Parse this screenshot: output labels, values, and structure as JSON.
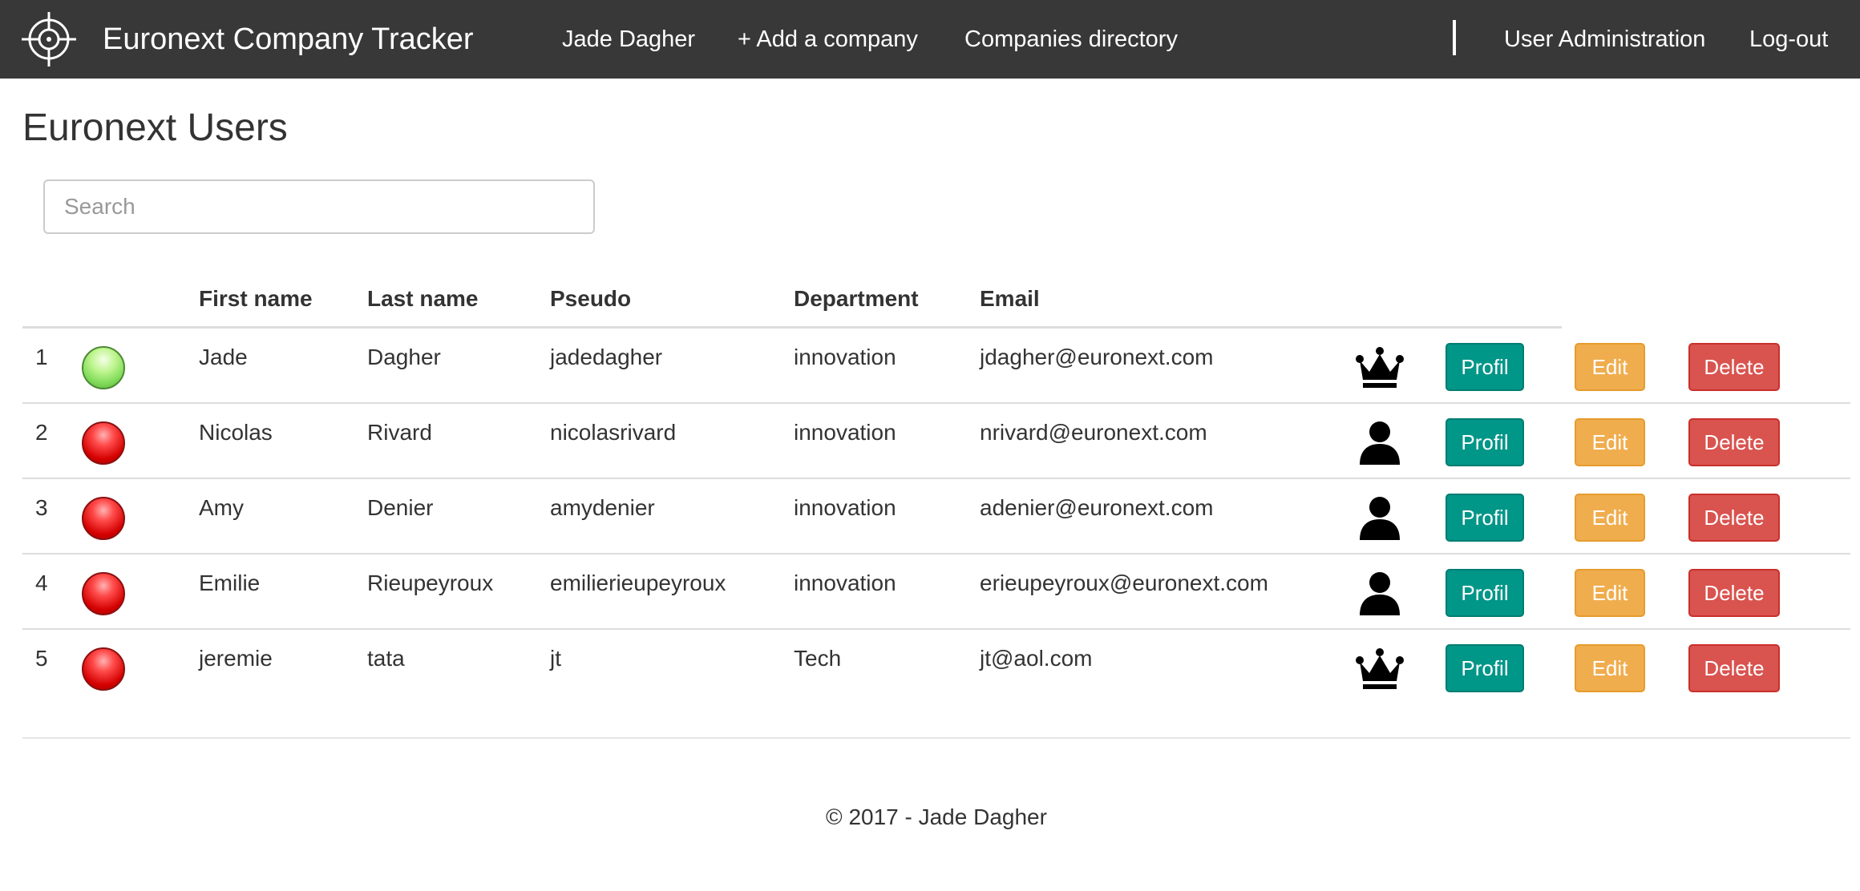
{
  "navbar": {
    "brand_title": "Euronext Company Tracker",
    "links": {
      "user_name": "Jade Dagher",
      "add_company": "+ Add a company",
      "companies_directory": "Companies directory",
      "user_administration": "User Administration",
      "logout": "Log-out"
    },
    "background_color": "#383838"
  },
  "page": {
    "title": "Euronext Users"
  },
  "search": {
    "placeholder": "Search",
    "value": ""
  },
  "table": {
    "headers": {
      "index": "",
      "status": "",
      "first_name": "First name",
      "last_name": "Last name",
      "pseudo": "Pseudo",
      "department": "Department",
      "email": "Email"
    },
    "rows": [
      {
        "index": "1",
        "status": "online",
        "first_name": "Jade",
        "last_name": "Dagher",
        "pseudo": "jadedagher",
        "department": "innovation",
        "email": "jdagher@euronext.com",
        "role_icon": "crown-icon"
      },
      {
        "index": "2",
        "status": "offline",
        "first_name": "Nicolas",
        "last_name": "Rivard",
        "pseudo": "nicolasrivard",
        "department": "innovation",
        "email": "nrivard@euronext.com",
        "role_icon": "user-icon"
      },
      {
        "index": "3",
        "status": "offline",
        "first_name": "Amy",
        "last_name": "Denier",
        "pseudo": "amydenier",
        "department": "innovation",
        "email": "adenier@euronext.com",
        "role_icon": "user-icon"
      },
      {
        "index": "4",
        "status": "offline",
        "first_name": "Emilie",
        "last_name": "Rieupeyroux",
        "pseudo": "emilierieupeyroux",
        "department": "innovation",
        "email": "erieupeyroux@euronext.com",
        "role_icon": "user-icon"
      },
      {
        "index": "5",
        "status": "offline",
        "first_name": "jeremie",
        "last_name": "tata",
        "pseudo": "jt",
        "department": "Tech",
        "email": "jt@aol.com",
        "role_icon": "crown-icon"
      }
    ],
    "actions": {
      "profil_label": "Profil",
      "edit_label": "Edit",
      "delete_label": "Delete"
    }
  },
  "colors": {
    "profil": "#009688",
    "edit": "#f0ad4e",
    "delete": "#d9534f",
    "status_online": "#7ed957",
    "status_offline": "#e00000"
  },
  "footer": {
    "text": "© 2017 - Jade Dagher"
  }
}
